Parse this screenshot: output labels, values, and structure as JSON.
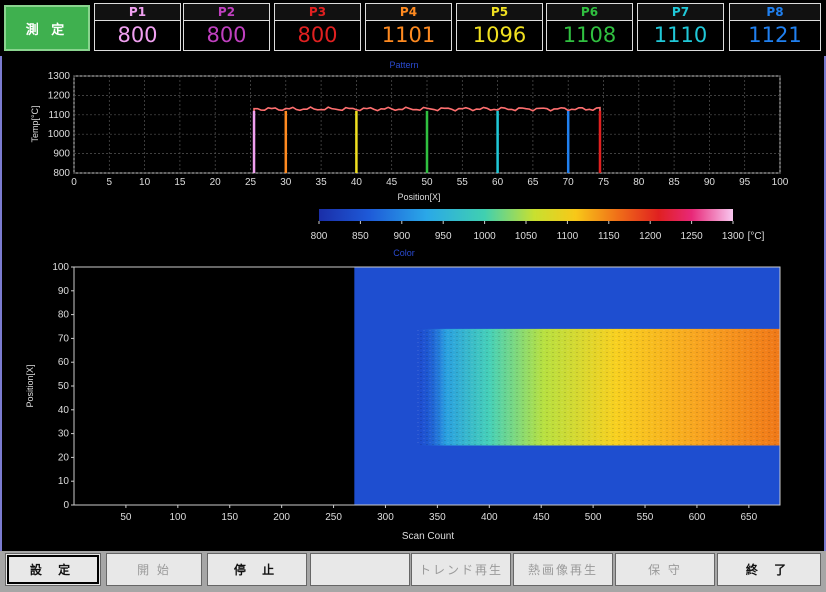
{
  "measure_button": "測 定",
  "channels": [
    {
      "label": "P1",
      "value": "800",
      "color": "#f0a0f0"
    },
    {
      "label": "P2",
      "value": "800",
      "color": "#c040c0"
    },
    {
      "label": "P3",
      "value": "800",
      "color": "#e02020"
    },
    {
      "label": "P4",
      "value": "1101",
      "color": "#ff8a20"
    },
    {
      "label": "P5",
      "value": "1096",
      "color": "#f0e020"
    },
    {
      "label": "P6",
      "value": "1108",
      "color": "#30c040"
    },
    {
      "label": "P7",
      "value": "1110",
      "color": "#20c8d8"
    },
    {
      "label": "P8",
      "value": "1121",
      "color": "#2080f0"
    }
  ],
  "pattern_chart": {
    "title": "Pattern",
    "xlabel": "Position[X]",
    "ylabel": "Temp[°C]",
    "xticks": [
      "0",
      "5",
      "10",
      "15",
      "20",
      "25",
      "30",
      "35",
      "40",
      "45",
      "50",
      "55",
      "60",
      "65",
      "70",
      "75",
      "80",
      "85",
      "90",
      "95",
      "100"
    ],
    "yticks": [
      "800",
      "900",
      "1000",
      "1100",
      "1200",
      "1300"
    ]
  },
  "colorbar": {
    "ticks": [
      "800",
      "850",
      "900",
      "950",
      "1000",
      "1050",
      "1100",
      "1150",
      "1200",
      "1250",
      "1300"
    ],
    "unit": "[°C]"
  },
  "color_chart": {
    "title": "Color",
    "xlabel": "Scan Count",
    "ylabel": "Position[X]",
    "xticks": [
      "50",
      "100",
      "150",
      "200",
      "250",
      "300",
      "350",
      "400",
      "450",
      "500",
      "550",
      "600",
      "650"
    ],
    "yticks": [
      "0",
      "10",
      "20",
      "30",
      "40",
      "50",
      "60",
      "70",
      "80",
      "90",
      "100"
    ]
  },
  "chart_data": [
    {
      "type": "line",
      "title": "Pattern",
      "xlabel": "Position[X]",
      "ylabel": "Temp[°C]",
      "xlim": [
        0,
        100
      ],
      "ylim": [
        800,
        1300
      ],
      "series": [
        {
          "x": [
            25.5,
            25.5,
            74.5,
            74.5
          ],
          "y": [
            800,
            1130,
            1130,
            800
          ],
          "color": "#ff7070"
        }
      ],
      "markers": [
        {
          "x": 25.5,
          "color": "#f0a0f0"
        },
        {
          "x": 30,
          "color": "#ff8a20"
        },
        {
          "x": 40,
          "color": "#f0e020"
        },
        {
          "x": 50,
          "color": "#30c040"
        },
        {
          "x": 60,
          "color": "#20c8d8"
        },
        {
          "x": 70,
          "color": "#2080f0"
        },
        {
          "x": 74.5,
          "color": "#e02020"
        }
      ]
    },
    {
      "type": "heatmap",
      "title": "Color",
      "xlabel": "Scan Count",
      "ylabel": "Position[X]",
      "xlim": [
        0,
        680
      ],
      "ylim": [
        0,
        100
      ],
      "background_start": 270,
      "hot_band": [
        25,
        74
      ],
      "hot_start": 330,
      "value_range": [
        800,
        1300
      ]
    }
  ],
  "buttons": [
    {
      "label": "設 定",
      "enabled": true
    },
    {
      "label": "開 始",
      "enabled": false
    },
    {
      "label": "停 止",
      "enabled": true
    },
    {
      "label": "",
      "enabled": false
    },
    {
      "label": "トレンド再生",
      "enabled": false
    },
    {
      "label": "熱画像再生",
      "enabled": false
    },
    {
      "label": "保 守",
      "enabled": false
    },
    {
      "label": "終 了",
      "enabled": true
    }
  ]
}
